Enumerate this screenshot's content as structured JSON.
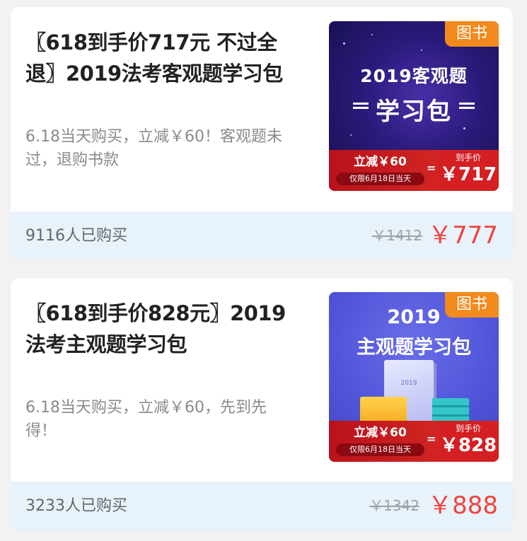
{
  "products": [
    {
      "title": "〖618到手价717元 不过全退〗2019法考客观题学习包",
      "description": "6.18当天购买，立减￥60！客观题未过，退购书款",
      "cover": {
        "tag": "图书",
        "headline_line1": "2019客观题",
        "headline_line2": "学习包",
        "promo_discount": "立减￥60",
        "promo_date": "仅限6月18日当天",
        "promo_equals": "=",
        "promo_final_label": "到手价",
        "promo_final_price": "￥717"
      },
      "buyers": "9116人已购买",
      "original_price": "￥1412",
      "price": "￥777"
    },
    {
      "title": "〖618到手价828元〗2019法考主观题学习包",
      "description": "6.18当天购买，立减￥60，先到先得！",
      "cover": {
        "tag": "图书",
        "headline_line1": "2019",
        "headline_line2": "主观题学习包",
        "book_label": "2019",
        "promo_discount": "立减￥60",
        "promo_date": "仅限6月18日当天",
        "promo_equals": "=",
        "promo_final_label": "到手价",
        "promo_final_price": "￥828"
      },
      "buyers": "3233人已购买",
      "original_price": "￥1342",
      "price": "￥888"
    }
  ],
  "colors": {
    "price_red": "#f0433c",
    "footer_bg": "#e7f2fb",
    "tag_orange": "#f28a1e",
    "page_bg": "#f2f2f2"
  }
}
